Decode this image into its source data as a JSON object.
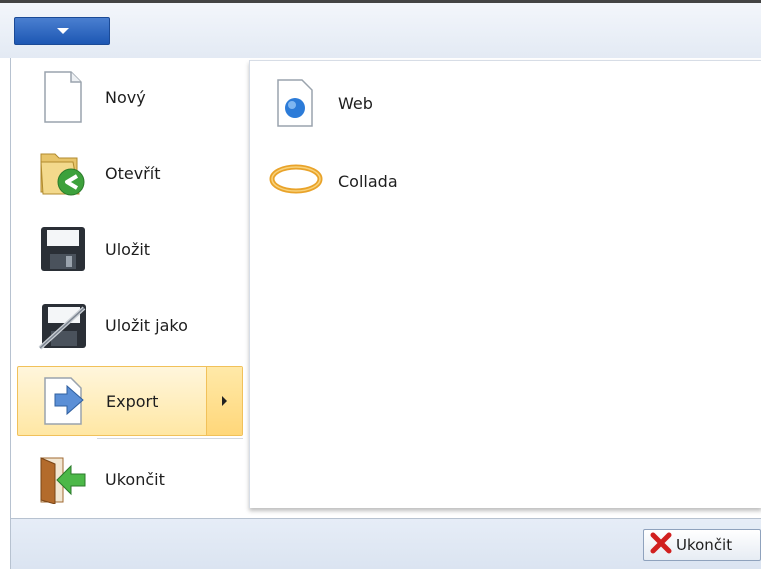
{
  "app_menu": {
    "icon": "chevron-down-icon",
    "accent": "#1d57b3"
  },
  "menu": {
    "items": [
      {
        "label": "Nový",
        "icon": "new-document-icon"
      },
      {
        "label": "Otevřít",
        "icon": "open-folder-icon"
      },
      {
        "label": "Uložit",
        "icon": "save-disk-icon"
      },
      {
        "label": "Uložit jako",
        "icon": "save-as-disk-icon"
      },
      {
        "label": "Export",
        "icon": "export-icon",
        "state": "hover",
        "has_submenu": true
      },
      {
        "label": "Ukončit",
        "icon": "exit-door-icon"
      }
    ]
  },
  "submenu": {
    "items": [
      {
        "label": "Web",
        "icon": "web-document-icon"
      },
      {
        "label": "Collada",
        "icon": "collada-ring-icon"
      }
    ]
  },
  "footer": {
    "exit_button": {
      "label": "Ukončit",
      "icon": "red-x-icon",
      "color": "#d1201f"
    }
  },
  "colors": {
    "hover_bg": "#ffe7a4",
    "hover_border": "#f1c15a",
    "footer_bg": "#dbe4f1"
  }
}
